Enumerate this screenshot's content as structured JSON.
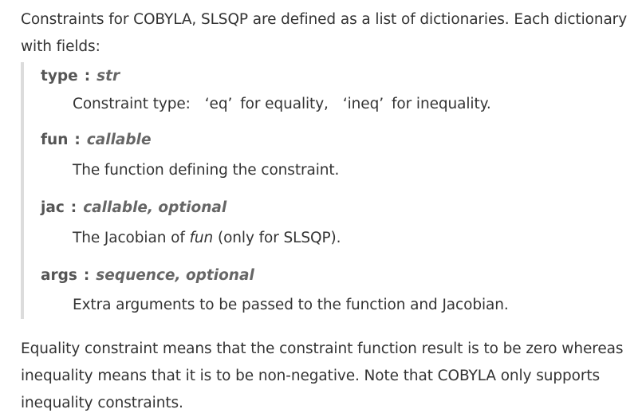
{
  "intro": "Constraints for COBYLA, SLSQP are defined as a list of dictionaries. Each dictionary with fields:",
  "fields": [
    {
      "name": "type",
      "type": "str",
      "desc_prefix": "Constraint type:",
      "eq_literal": "‘eq’",
      "eq_text": "for equality,",
      "ineq_literal": "‘ineq’",
      "ineq_text": "for inequality."
    },
    {
      "name": "fun",
      "type": "callable",
      "desc": "The function defining the constraint."
    },
    {
      "name": "jac",
      "type": "callable, optional",
      "desc_prefix": "The Jacobian of",
      "desc_em": "fun",
      "desc_suffix": "(only for SLSQP)."
    },
    {
      "name": "args",
      "type": "sequence, optional",
      "desc": "Extra arguments to be passed to the function and Jacobian."
    }
  ],
  "separator": ":",
  "outro": "Equality constraint means that the constraint function result is to be zero whereas inequality means that it is to be non-negative. Note that COBYLA only supports inequality constraints."
}
